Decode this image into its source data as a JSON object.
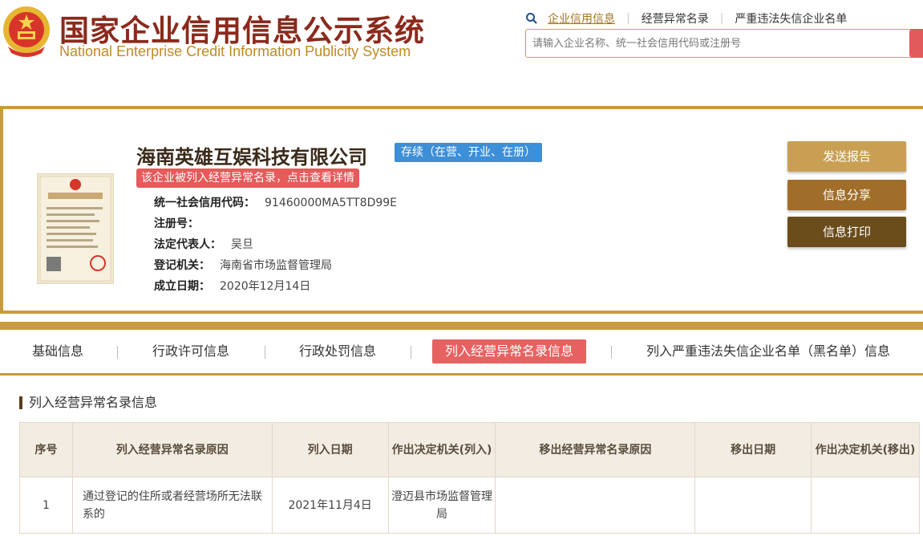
{
  "header": {
    "title_cn": "国家企业信用信息公示系统",
    "title_en": "National Enterprise Credit Information Publicity System",
    "nav": [
      {
        "label": "企业信用信息"
      },
      {
        "label": "经营异常名录"
      },
      {
        "label": "严重违法失信企业名单"
      }
    ],
    "search_placeholder": "请输入企业名称、统一社会信用代码或注册号"
  },
  "company": {
    "name": "海南英雄互娱科技有限公司",
    "status": "存续（在营、开业、在册）",
    "alert": "该企业被列入经营异常名录，点击查看详情",
    "fields": [
      {
        "label": "统一社会信用代码：",
        "value": "91460000MA5TT8D99E"
      },
      {
        "label": "注册号：",
        "value": ""
      },
      {
        "label": "法定代表人：",
        "value": "吴旦"
      },
      {
        "label": "登记机关：",
        "value": "海南省市场监督管理局"
      },
      {
        "label": "成立日期：",
        "value": "2020年12月14日"
      }
    ]
  },
  "actions": {
    "report": "发送报告",
    "share": "信息分享",
    "print": "信息打印"
  },
  "tabs": [
    {
      "label": "基础信息"
    },
    {
      "label": "行政许可信息"
    },
    {
      "label": "行政处罚信息"
    },
    {
      "label": "列入经营异常名录信息"
    },
    {
      "label": "列入严重违法失信企业名单（黑名单）信息"
    }
  ],
  "section": {
    "title": "列入经营异常名录信息",
    "columns": [
      "序号",
      "列入经营异常名录原因",
      "列入日期",
      "作出决定机关(列入)",
      "移出经营异常名录原因",
      "移出日期",
      "作出决定机关(移出)"
    ],
    "rows": [
      {
        "index": "1",
        "reason": "通过登记的住所或者经营场所无法联系的",
        "date": "2021年11月4日",
        "authority": "澄迈县市场监督管理局",
        "remove_reason": "",
        "remove_date": "",
        "remove_authority": ""
      }
    ]
  },
  "colors": {
    "gold": "#c99c3b",
    "brown": "#8b2a1c",
    "status_blue": "#3d8fd8",
    "alert_red": "#e65a5a"
  }
}
